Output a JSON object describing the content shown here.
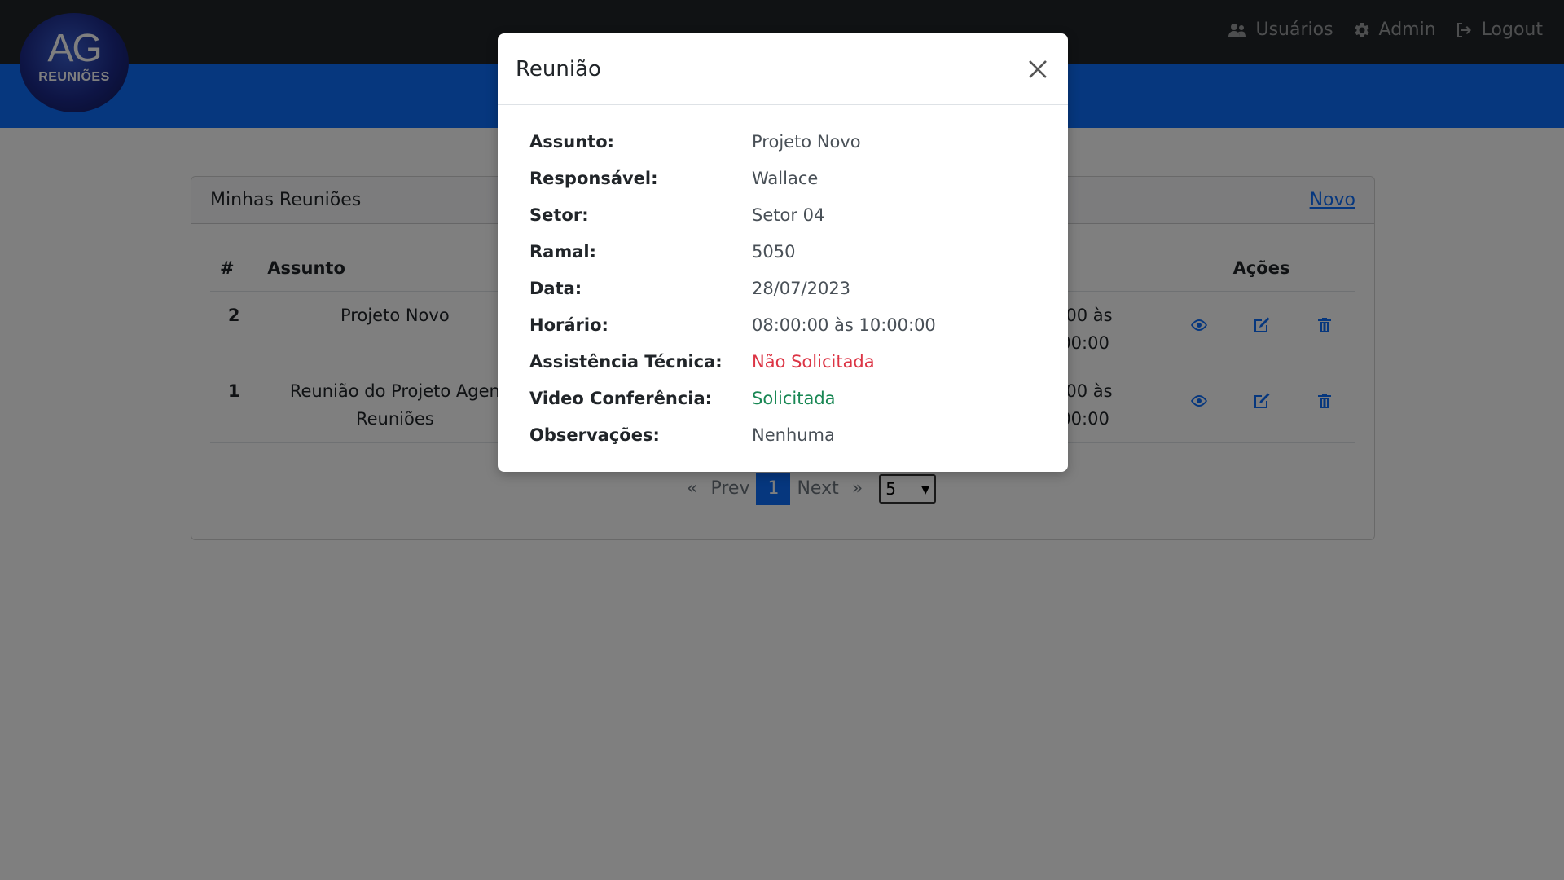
{
  "brand": {
    "monogram": "AG",
    "word": "REUNIÕES"
  },
  "nav": {
    "users": "Usuários",
    "admin": "Admin",
    "logout": "Logout"
  },
  "card": {
    "title": "Minhas Reuniões",
    "new_link": "Novo"
  },
  "table": {
    "headers": {
      "num": "#",
      "subject": "Assunto",
      "actions": "Ações"
    },
    "rows": [
      {
        "num": "2",
        "subject": "Projeto Novo",
        "time_line1": ":00 às",
        "time_line2": "00:00"
      },
      {
        "num": "1",
        "subject_line1": "Reunião do Projeto Agen",
        "subject_line2": "Reuniões",
        "time_line1": ":00 às",
        "time_line2": "00:00"
      }
    ]
  },
  "pagination": {
    "first": "«",
    "prev": "Prev",
    "current": "1",
    "next": "Next",
    "last": "»",
    "page_size": "5"
  },
  "modal": {
    "title": "Reunião",
    "fields": [
      {
        "label": "Assunto:",
        "value": "Projeto Novo"
      },
      {
        "label": "Responsável:",
        "value": "Wallace"
      },
      {
        "label": "Setor:",
        "value": "Setor 04"
      },
      {
        "label": "Ramal:",
        "value": "5050"
      },
      {
        "label": "Data:",
        "value": "28/07/2023"
      },
      {
        "label": "Horário:",
        "value": "08:00:00 às 10:00:00"
      },
      {
        "label": "Assistência Técnica:",
        "value": "Não Solicitada"
      },
      {
        "label": "Video Conferência:",
        "value": "Solicitada"
      },
      {
        "label": "Observações:",
        "value": "Nenhuma"
      }
    ]
  },
  "colors": {
    "topbar": "#212529",
    "primary": "#0d6efd",
    "danger": "#dc3545",
    "success": "#198754"
  },
  "icons": [
    "users-icon",
    "gear-icon",
    "logout-icon",
    "eye-icon",
    "edit-icon",
    "trash-icon",
    "close-icon"
  ]
}
